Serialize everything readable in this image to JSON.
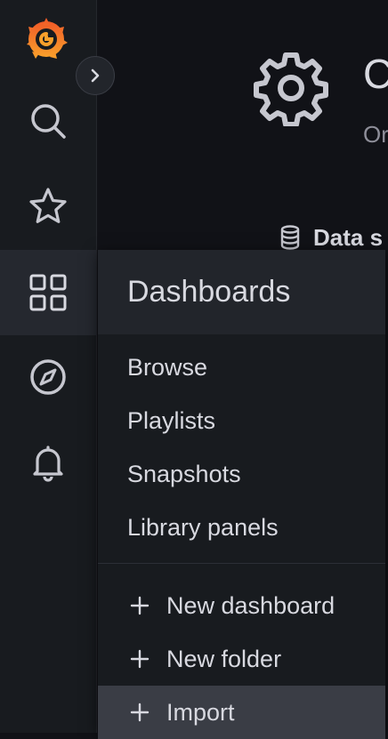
{
  "colors": {
    "accent": "#f55f3e",
    "logo_orange": "#f9a02b",
    "icon": "#c6c7cf"
  },
  "sidebar": {
    "toggle_icon": "chevron-right-icon",
    "items": [
      {
        "name": "search",
        "icon": "search-icon"
      },
      {
        "name": "starred",
        "icon": "star-icon"
      },
      {
        "name": "dashboards",
        "icon": "apps-grid-icon",
        "active": true
      },
      {
        "name": "explore",
        "icon": "compass-icon"
      },
      {
        "name": "alerting",
        "icon": "bell-icon"
      }
    ]
  },
  "main": {
    "title": "C",
    "subtitle": "Or",
    "tab_label": "Data s",
    "tab_icon": "database-icon"
  },
  "dashboards_menu": {
    "title": "Dashboards",
    "items": [
      "Browse",
      "Playlists",
      "Snapshots",
      "Library panels"
    ],
    "actions": [
      "New dashboard",
      "New folder",
      "Import"
    ]
  }
}
